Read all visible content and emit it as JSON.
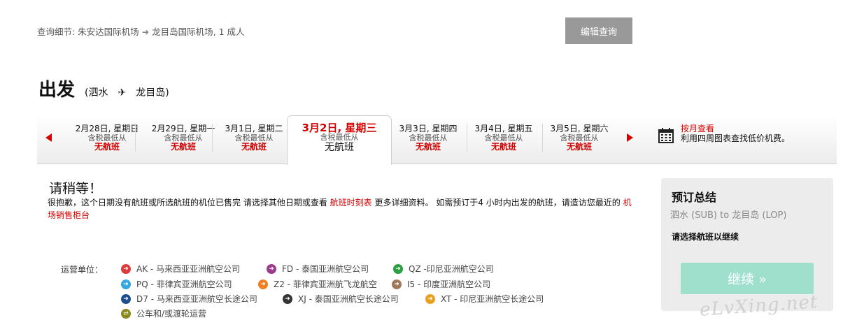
{
  "query": {
    "prefix": "查询细节: 朱安达国际机场",
    "arrow": "➜",
    "suffix": "龙目岛国际机场, 1 成人",
    "edit_label": "编辑查询"
  },
  "departure": {
    "heading": "出发",
    "open": "(泗水",
    "plane": "✈",
    "close": "龙目岛)"
  },
  "dates": [
    {
      "date": "2月28日, 星期日",
      "sub": "含税最低从",
      "status": "无航班"
    },
    {
      "date": "2月29日, 星期一",
      "sub": "含税最低从",
      "status": "无航班"
    },
    {
      "date": "3月1日, 星期二",
      "sub": "含税最低从",
      "status": "无航班"
    },
    {
      "date": "3月2日, 星期三",
      "sub": "含税最低从",
      "status": "无航班"
    },
    {
      "date": "3月3日, 星期四",
      "sub": "含税最低从",
      "status": "无航班"
    },
    {
      "date": "3月4日, 星期五",
      "sub": "含税最低从",
      "status": "无航班"
    },
    {
      "date": "3月5日, 星期六",
      "sub": "含税最低从",
      "status": "无航班"
    }
  ],
  "month_view": {
    "link": "按月查看",
    "desc": "利用四周图表查找低价机费。"
  },
  "wait": {
    "title": "请稍等！",
    "msg_1": "很抱歉，这个日期没有航班或所选航班的机位已售完 请选择其他日期或查看 ",
    "link_1": "航班时刻表",
    "msg_2": " 更多详细资料。 如需预订于4 小时内出发的航班，请造访您最近的 ",
    "link_2": "机场销售柜台"
  },
  "operators": {
    "label": "运营单位：",
    "items": [
      {
        "code": "AK - 马来西亚亚洲航空公司",
        "color": "#e03a3a"
      },
      {
        "code": "FD - 泰国亚洲航空公司",
        "color": "#9c3a8c"
      },
      {
        "code": "QZ -印尼亚洲航空公司",
        "color": "#2aa040"
      },
      {
        "code": "PQ - 菲律宾亚洲航空公司",
        "color": "#35a8e0"
      },
      {
        "code": "Z2 - 菲律宾亚洲航飞龙航空",
        "color": "#f07d1e"
      },
      {
        "code": "I5 - 印度亚洲航空公司",
        "color": "#a0785a"
      },
      {
        "code": "D7 - 马来西亚亚洲航空长途公司",
        "color": "#1d4f8c"
      },
      {
        "code": "XJ - 泰国亚洲航空长途公司",
        "color": "#333333"
      },
      {
        "code": "XT - 印尼亚洲航空长途公司",
        "color": "#e8a020"
      },
      {
        "code": "公车和/或渡轮运营",
        "color": "#8a8a1e"
      }
    ]
  },
  "summary": {
    "title": "预订总结",
    "route": "泗水 (SUB) to 龙目岛 (LOP)",
    "hint": "请选择航班以继续",
    "continue_label": "继续 »"
  },
  "watermark": "eLvXing.net"
}
